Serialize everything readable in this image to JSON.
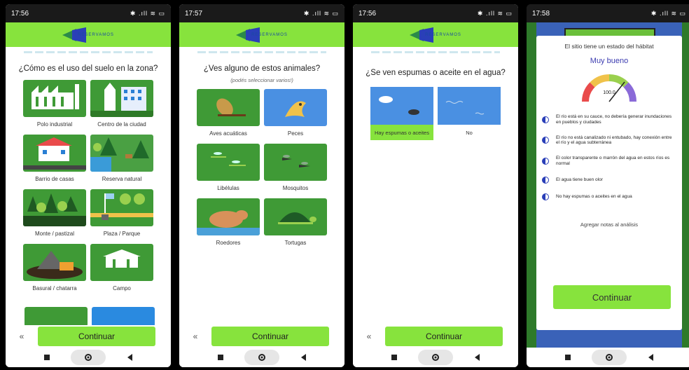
{
  "brand": "RESERVAMOS",
  "colors": {
    "accent": "#87e33d",
    "tile_green": "#3f9a36",
    "tile_blue": "#4a90e2",
    "verdict": "#3b3bb0"
  },
  "screens": [
    {
      "time": "17:56",
      "status_right": "✱ .ıll ≋ ▭",
      "question": "¿Cómo es el uso del suelo en la zona?",
      "tiles": [
        "Polo industrial",
        "Centro de la ciudad",
        "Barrio de casas",
        "Reserva natural",
        "Monte / pastizal",
        "Plaza / Parque",
        "Basural / chatarra",
        "Campo"
      ],
      "back": "«",
      "continue": "Continuar"
    },
    {
      "time": "17:57",
      "status_right": "✱ .ıll ≋ ▭",
      "question": "¿Ves alguno de estos animales?",
      "subtitle": "(podés seleccionar varios!)",
      "tiles": [
        "Aves acuáticas",
        "Peces",
        "Libélulas",
        "Mosquitos",
        "Roedores",
        "Tortugas"
      ],
      "back": "«",
      "continue": "Continuar"
    },
    {
      "time": "17:56",
      "status_right": "✱ .ıll ≋ ▭",
      "question": "¿Se ven espumas o aceite en el agua?",
      "tiles": [
        "Hay espumas o aceites",
        "No"
      ],
      "back": "«",
      "continue": "Continuar"
    },
    {
      "time": "17:58",
      "status_right": "✱ .ıll ≋ ▭",
      "header": "El sitio tiene un estado del hábitat",
      "verdict": "Muy bueno",
      "gauge_value": "100.0",
      "items": [
        "El río está en su cauce, no debería generar inundaciones en pueblos y ciudades",
        "El río no está canalizado ni entubado, hay conexión entre el río y el agua subterránea",
        "El color transparente o marrón del agua en estos ríos es normal",
        "El agua tiene buen olor",
        "No hay espumas o aceites en el agua"
      ],
      "notes": "Agregar notas al análisis",
      "continue": "Continuar"
    }
  ]
}
